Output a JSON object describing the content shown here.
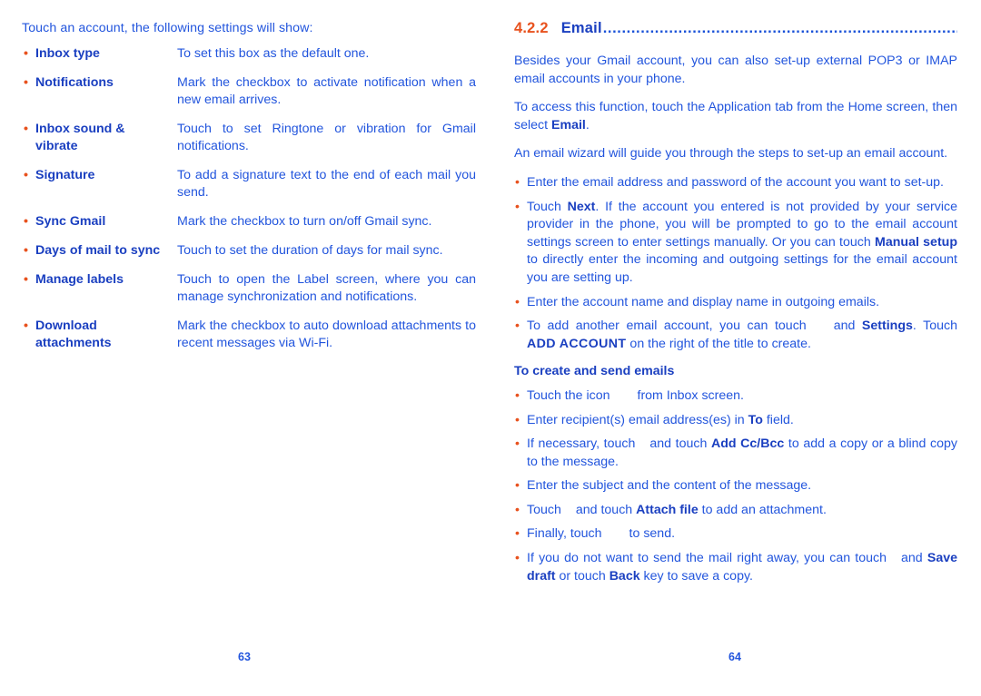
{
  "colors": {
    "body_blue": "#2255dd",
    "bold_blue": "#1a3fc0",
    "accent_orange": "#e8521e",
    "background": "#ffffff"
  },
  "bullet_glyph": "•",
  "left_page": {
    "intro": "Touch an account, the following settings will show:",
    "settings": [
      {
        "term": "Inbox type",
        "description": "To set this box as the default one.",
        "justified": false
      },
      {
        "term": "Notifications",
        "description": "Mark the checkbox to activate notification when a new email arrives.",
        "justified": true
      },
      {
        "term": "Inbox sound & vibrate",
        "description": "Touch to set Ringtone or vibration for Gmail notifications.",
        "justified": true
      },
      {
        "term": "Signature",
        "description": "To add a signature text to the end of each mail you send.",
        "justified": true
      },
      {
        "term": "Sync Gmail",
        "description": "Mark the checkbox to turn on/off Gmail sync.",
        "justified": false
      },
      {
        "term": "Days of mail to sync",
        "description": "Touch to set the duration of days for mail sync.",
        "justified": false
      },
      {
        "term": "Manage labels",
        "description": "Touch to open the Label screen, where you can manage synchronization and notifications.",
        "justified": true
      },
      {
        "term": "Download attachments",
        "description": "Mark the checkbox to auto download attachments to recent messages via Wi-Fi.",
        "justified": true
      }
    ],
    "folio": "63"
  },
  "right_page": {
    "section": {
      "number": "4.2.2",
      "title": "Email",
      "leader": "................................................................................."
    },
    "paragraphs": [
      "Besides your Gmail account, you can also set-up external POP3 or IMAP email accounts in your phone."
    ],
    "para_access": {
      "before": "To access this function, touch the Application tab from the Home screen, then select ",
      "bold": "Email",
      "after": "."
    },
    "para_wizard": "An email wizard will guide you through the steps to set-up an email account.",
    "setup_bullets": {
      "b1": "Enter the email address and password of the account you want to set-up.",
      "b2": {
        "p1": "Touch ",
        "b1": "Next",
        "p2": ". If the account you entered is not provided by your service provider in the phone, you will be prompted to go to the email account settings screen to enter settings manually. Or you can touch ",
        "b2": "Manual setup",
        "p3": " to directly enter the incoming and outgoing settings for the email account you are setting up."
      },
      "b3": "Enter the account name and display name in outgoing emails.",
      "b4": {
        "p1": "To add another email account, you can touch",
        "p2": "and ",
        "b1": "Settings",
        "p3": ". Touch ",
        "b2": "ADD ACCOUNT",
        "p4": " on the right of the title to create."
      }
    },
    "create_send": {
      "heading": "To create and send emails",
      "b1": {
        "p1": "Touch the icon",
        "p2": "from Inbox screen."
      },
      "b2": {
        "p1": "Enter recipient(s) email address(es) in ",
        "b1": "To",
        "p2": " field."
      },
      "b3": {
        "p1": "If necessary, touch",
        "p2": "and touch ",
        "b1": "Add Cc/Bcc",
        "p3": " to add a copy or a blind copy to the message."
      },
      "b4": "Enter the subject and the content of the message.",
      "b5": {
        "p1": "Touch",
        "p2": "and touch ",
        "b1": "Attach file",
        "p3": " to add an attachment."
      },
      "b6": {
        "p1": "Finally, touch",
        "p2": "to send."
      },
      "b7": {
        "p1": "If you do not want to send the mail right away, you can touch",
        "p2": "and ",
        "b1": "Save draft",
        "p3": " or touch ",
        "b2": "Back",
        "p4": " key to save a copy."
      }
    },
    "folio": "64"
  }
}
